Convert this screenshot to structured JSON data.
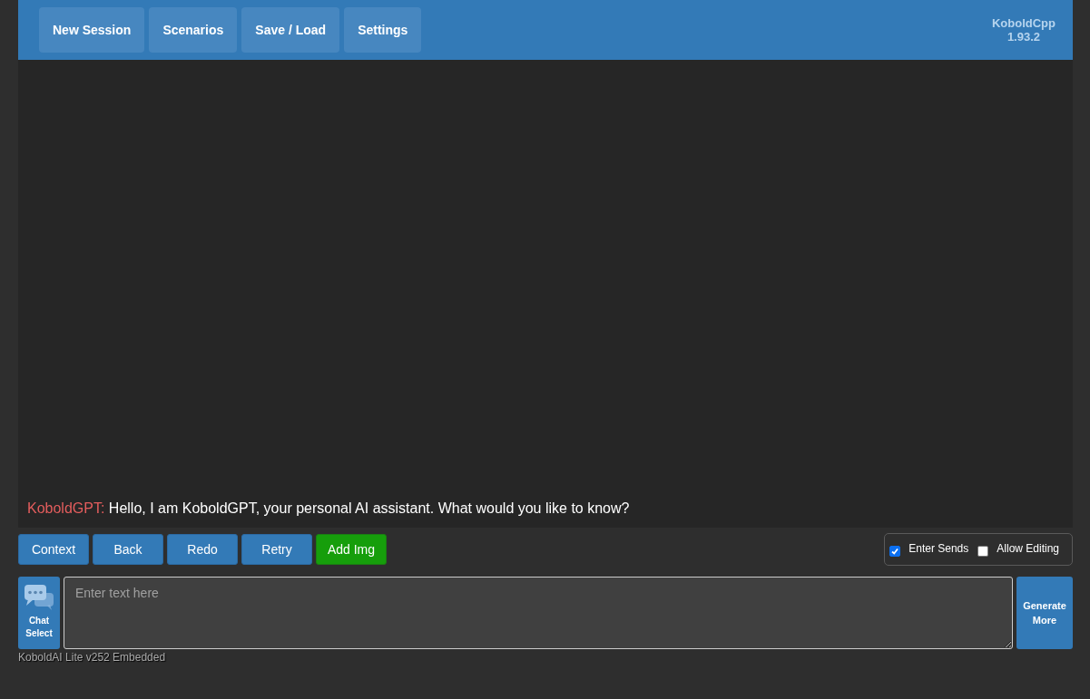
{
  "nav": [
    {
      "label": "New Session"
    },
    {
      "label": "Scenarios"
    },
    {
      "label": "Save / Load"
    },
    {
      "label": "Settings"
    }
  ],
  "version": {
    "name": "KoboldCpp",
    "number": "1.93.2"
  },
  "messages": [
    {
      "speaker": "KoboldGPT:",
      "text": "Hello, I am KoboldGPT, your personal AI assistant. What would you like to know?"
    }
  ],
  "actions": [
    {
      "label": "Context",
      "kind": "primary"
    },
    {
      "label": "Back",
      "kind": "primary"
    },
    {
      "label": "Redo",
      "kind": "primary"
    },
    {
      "label": "Retry",
      "kind": "primary"
    },
    {
      "label": "Add Img",
      "kind": "success"
    }
  ],
  "options": [
    {
      "label": "Enter Sends",
      "checked": true
    },
    {
      "label": "Allow Editing",
      "checked": false
    }
  ],
  "chat_select": {
    "label": "Chat Select"
  },
  "input": {
    "placeholder": "Enter text here"
  },
  "generate": {
    "label": "Generate More"
  },
  "footer": "KoboldAI Lite v252 Embedded"
}
